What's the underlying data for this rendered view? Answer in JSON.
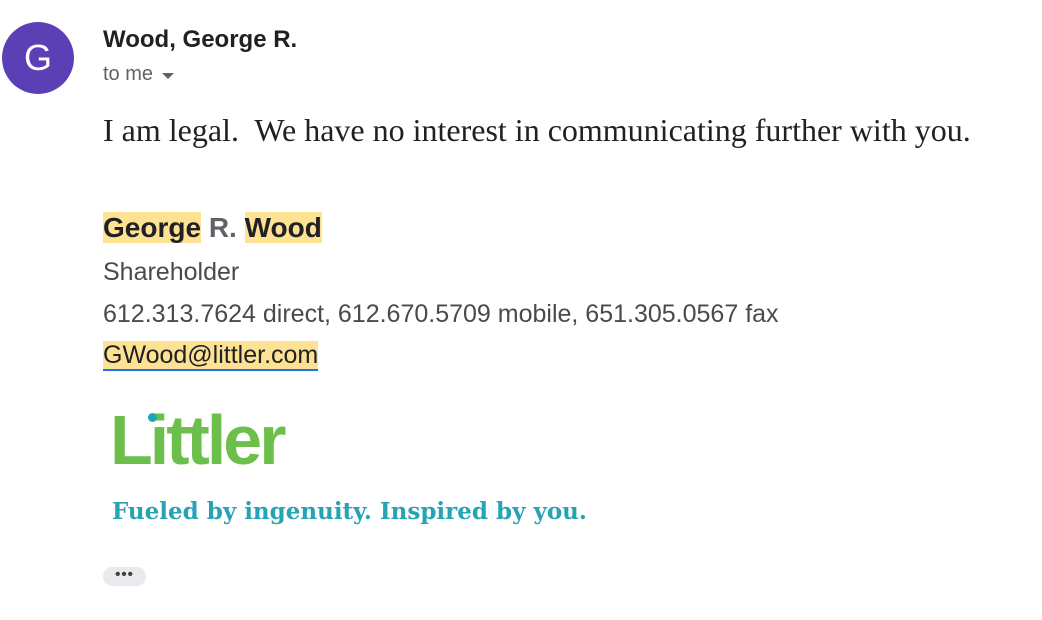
{
  "sender": {
    "avatar_letter": "G",
    "avatar_color": "#5b3fb5",
    "name": "Wood, George R."
  },
  "recipient": {
    "label": "to me",
    "dropdown_icon": "caret-down-icon"
  },
  "message": {
    "body": "I am legal.  We have no interest in communicating further with you."
  },
  "signature": {
    "first_name": "George",
    "middle_initial": "R.",
    "last_name": "Wood",
    "title": "Shareholder",
    "phones": "612.313.7624 direct, 612.670.5709 mobile, 651.305.0567 fax",
    "email": "GWood@littler.com",
    "highlight_color": "#fde293"
  },
  "logo": {
    "brand": "Littler",
    "tagline": "Fueled by ingenuity. Inspired by you.",
    "brand_color": "#6cbf4b",
    "tagline_color": "#26a3b5"
  },
  "controls": {
    "show_trimmed": "•••"
  }
}
